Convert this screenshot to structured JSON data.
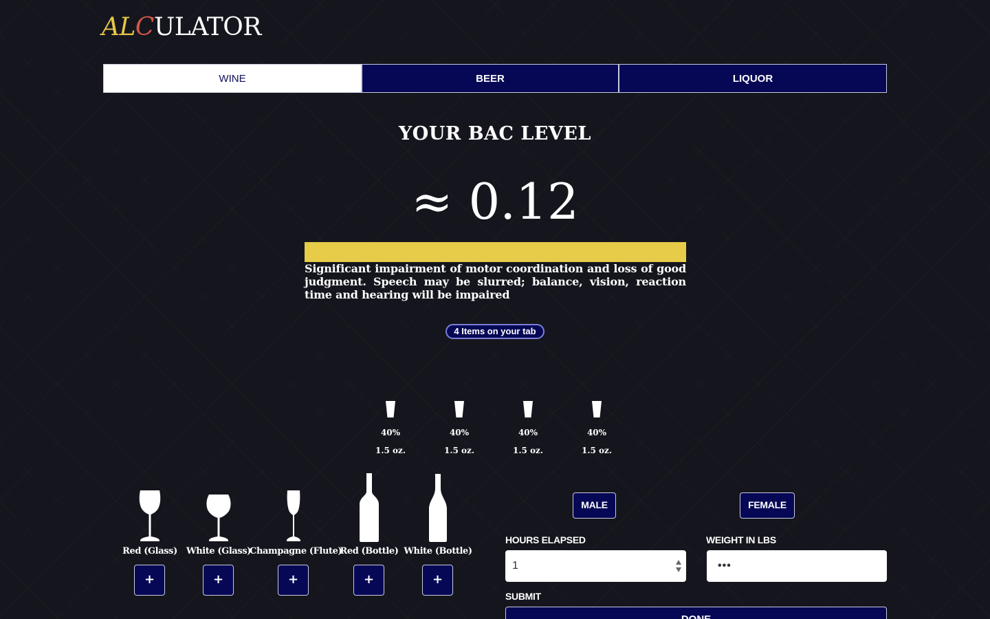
{
  "logo": {
    "part1": "AL",
    "part2": "C",
    "part3": "ULATOR"
  },
  "tabs": [
    {
      "label": "WINE",
      "active": true
    },
    {
      "label": "BEER",
      "active": false
    },
    {
      "label": "LIQUOR",
      "active": false
    }
  ],
  "bac": {
    "title": "YOUR BAC LEVEL",
    "value": "≈ 0.12",
    "bar_fill_fraction": 1.0,
    "description": "Significant impairment of motor coordination and loss of good judgment. Speech may be slurred; balance, vision, reaction time and hearing will be impaired"
  },
  "tab_count": "4 Items on your tab",
  "shots": [
    {
      "abv": "40%",
      "size": "1.5 oz."
    },
    {
      "abv": "40%",
      "size": "1.5 oz."
    },
    {
      "abv": "40%",
      "size": "1.5 oz."
    },
    {
      "abv": "40%",
      "size": "1.5 oz."
    }
  ],
  "drinks": [
    {
      "label": "Red (Glass)",
      "icon": "red-wine-glass-icon",
      "add_label": "+"
    },
    {
      "label": "White (Glass)",
      "icon": "white-wine-glass-icon",
      "add_label": "+"
    },
    {
      "label": "Champagne (Flute)",
      "icon": "champagne-flute-icon",
      "add_label": "+"
    },
    {
      "label": "Red (Bottle)",
      "icon": "red-wine-bottle-icon",
      "add_label": "+"
    },
    {
      "label": "White (Bottle)",
      "icon": "white-wine-bottle-icon",
      "add_label": "+"
    }
  ],
  "form": {
    "male_label": "MALE",
    "female_label": "FEMALE",
    "hours_label": "HOURS ELAPSED",
    "hours_value": "1",
    "weight_label": "WEIGHT IN LBS",
    "weight_value": "•••",
    "submit_label": "SUBMIT",
    "done_label": "DONE"
  },
  "colors": {
    "background": "#15161d",
    "navy": "#060856",
    "bar_yellow": "#e6cc48",
    "logo_yellow": "#e8c64a",
    "logo_red": "#d3574a"
  }
}
